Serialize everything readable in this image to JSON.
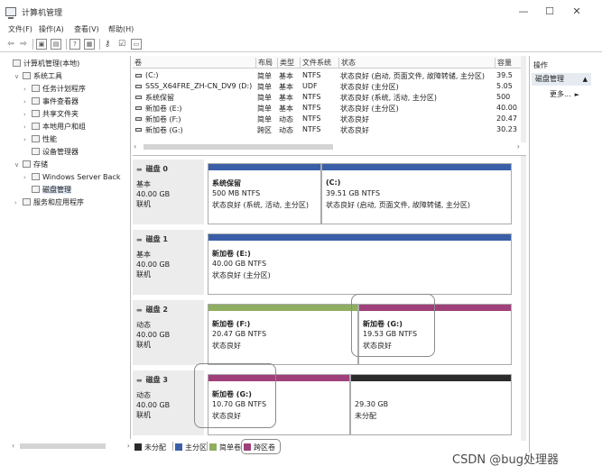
{
  "window": {
    "title": "计算机管理",
    "minimize": "—",
    "maximize": "☐",
    "close": "✕"
  },
  "menu": [
    "文件(F)",
    "操作(A)",
    "查看(V)",
    "帮助(H)"
  ],
  "tree": {
    "items": [
      {
        "label": "计算机管理(本地)"
      },
      {
        "label": "系统工具"
      },
      {
        "label": "任务计划程序"
      },
      {
        "label": "事件查看器"
      },
      {
        "label": "共享文件夹"
      },
      {
        "label": "本地用户和组"
      },
      {
        "label": "性能"
      },
      {
        "label": "设备管理器"
      },
      {
        "label": "存储"
      },
      {
        "label": "Windows Server Back"
      },
      {
        "label": "磁盘管理"
      },
      {
        "label": "服务和应用程序"
      }
    ]
  },
  "volumes": {
    "headers": [
      "卷",
      "布局",
      "类型",
      "文件系统",
      "状态",
      "容量"
    ],
    "rows": [
      {
        "volume": "(C:)",
        "layout": "简单",
        "type": "基本",
        "fs": "NTFS",
        "status": "状态良好 (启动, 页面文件, 故障转储, 主分区)",
        "capacity": "39.5"
      },
      {
        "volume": "SSS_X64FRE_ZH-CN_DV9 (D:)",
        "layout": "简单",
        "type": "基本",
        "fs": "UDF",
        "status": "状态良好 (主分区)",
        "capacity": "5.05"
      },
      {
        "volume": "系统保留",
        "layout": "简单",
        "type": "基本",
        "fs": "NTFS",
        "status": "状态良好 (系统, 活动, 主分区)",
        "capacity": "500"
      },
      {
        "volume": "新加卷 (E:)",
        "layout": "简单",
        "type": "基本",
        "fs": "NTFS",
        "status": "状态良好 (主分区)",
        "capacity": "40.00"
      },
      {
        "volume": "新加卷 (F:)",
        "layout": "简单",
        "type": "动态",
        "fs": "NTFS",
        "status": "状态良好",
        "capacity": "20.47"
      },
      {
        "volume": "新加卷 (G:)",
        "layout": "跨区",
        "type": "动态",
        "fs": "NTFS",
        "status": "状态良好",
        "capacity": "30.23"
      }
    ]
  },
  "disks": [
    {
      "name": "磁盘 0",
      "kind": "基本",
      "size": "40.00 GB",
      "state": "联机",
      "parts": [
        {
          "name": "系统保留",
          "size": "500 MB NTFS",
          "status": "状态良好 (系统, 活动, 主分区)",
          "color": "#3a5fa8"
        },
        {
          "name": "(C:)",
          "size": "39.51 GB NTFS",
          "status": "状态良好 (启动, 页面文件, 故障转储, 主分区)",
          "color": "#3a5fa8"
        }
      ]
    },
    {
      "name": "磁盘 1",
      "kind": "基本",
      "size": "40.00 GB",
      "state": "联机",
      "parts": [
        {
          "name": "新加卷 (E:)",
          "size": "40.00 GB NTFS",
          "status": "状态良好 (主分区)",
          "color": "#3a5fa8"
        }
      ]
    },
    {
      "name": "磁盘 2",
      "kind": "动态",
      "size": "40.00 GB",
      "state": "联机",
      "parts": [
        {
          "name": "新加卷 (F:)",
          "size": "20.47 GB NTFS",
          "status": "状态良好",
          "color": "#8fae61"
        },
        {
          "name": "新加卷 (G:)",
          "size": "19.53 GB NTFS",
          "status": "状态良好",
          "color": "#a0407a"
        }
      ]
    },
    {
      "name": "磁盘 3",
      "kind": "动态",
      "size": "40.00 GB",
      "state": "联机",
      "parts": [
        {
          "name": "新加卷 (G:)",
          "size": "10.70 GB NTFS",
          "status": "状态良好",
          "color": "#a0407a"
        },
        {
          "name": "",
          "size": "29.30 GB",
          "status": "未分配",
          "color": "#2b2b2b"
        }
      ]
    }
  ],
  "legend": [
    {
      "label": "未分配",
      "color": "#2b2b2b"
    },
    {
      "label": "主分区",
      "color": "#3a5fa8"
    },
    {
      "label": "简单卷",
      "color": "#8fae61"
    },
    {
      "label": "跨区卷",
      "color": "#a0407a"
    }
  ],
  "actions": {
    "header": "操作",
    "section": "磁盘管理",
    "more": "更多..."
  },
  "watermark": "CSDN @bug处理器"
}
